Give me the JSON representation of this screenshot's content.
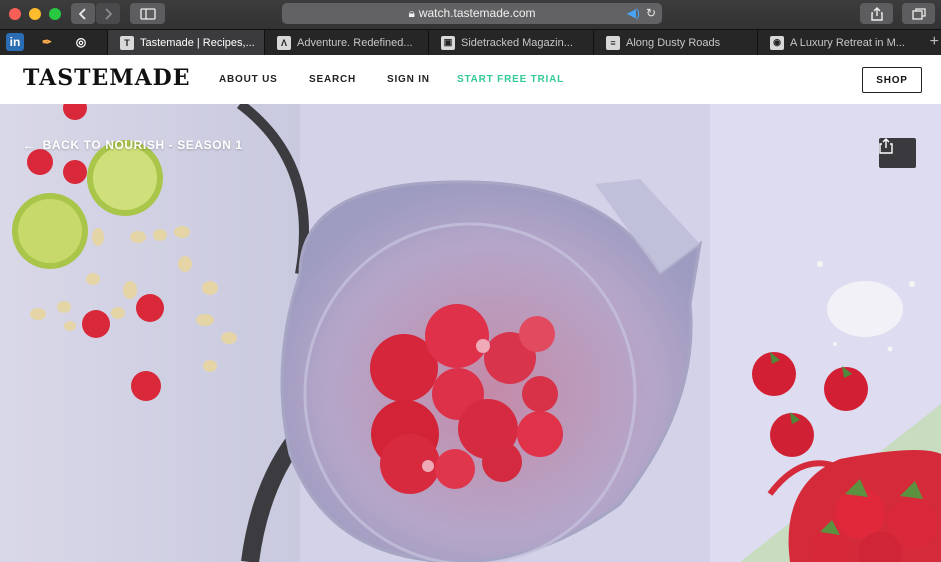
{
  "browser": {
    "url": "watch.tastemade.com",
    "pinned_tabs": [
      {
        "icon": "linkedin-icon",
        "glyph": "in"
      },
      {
        "icon": "feather-icon",
        "glyph": "✒"
      },
      {
        "icon": "weibo-icon",
        "glyph": "◎"
      }
    ],
    "tabs": [
      {
        "title": "Tastemade | Recipes,...",
        "icon": "tastemade-favicon",
        "glyph": "T",
        "active": true
      },
      {
        "title": "Adventure. Redefined...",
        "icon": "adventure-favicon",
        "glyph": "Λ",
        "active": false
      },
      {
        "title": "Sidetracked Magazin...",
        "icon": "sidetracked-favicon",
        "glyph": "▣",
        "active": false
      },
      {
        "title": "Along Dusty Roads",
        "icon": "dusty-roads-favicon",
        "glyph": "≡",
        "active": false
      },
      {
        "title": "A Luxury Retreat in M...",
        "icon": "retreat-favicon",
        "glyph": "◉",
        "active": false
      }
    ]
  },
  "site": {
    "logo": "TASTEMADE",
    "nav": {
      "about": "ABOUT US",
      "search": "SEARCH",
      "signin": "SIGN IN",
      "trial": "START FREE TRIAL"
    },
    "shop_label": "SHOP"
  },
  "hero": {
    "back_label": "BACK TO NOURISH - SEASON 1"
  },
  "colors": {
    "accent_trial": "#35c99a",
    "hero_background": "#cfd0e6",
    "strawberry": "#d8283a",
    "lime": "#a9c54a"
  }
}
